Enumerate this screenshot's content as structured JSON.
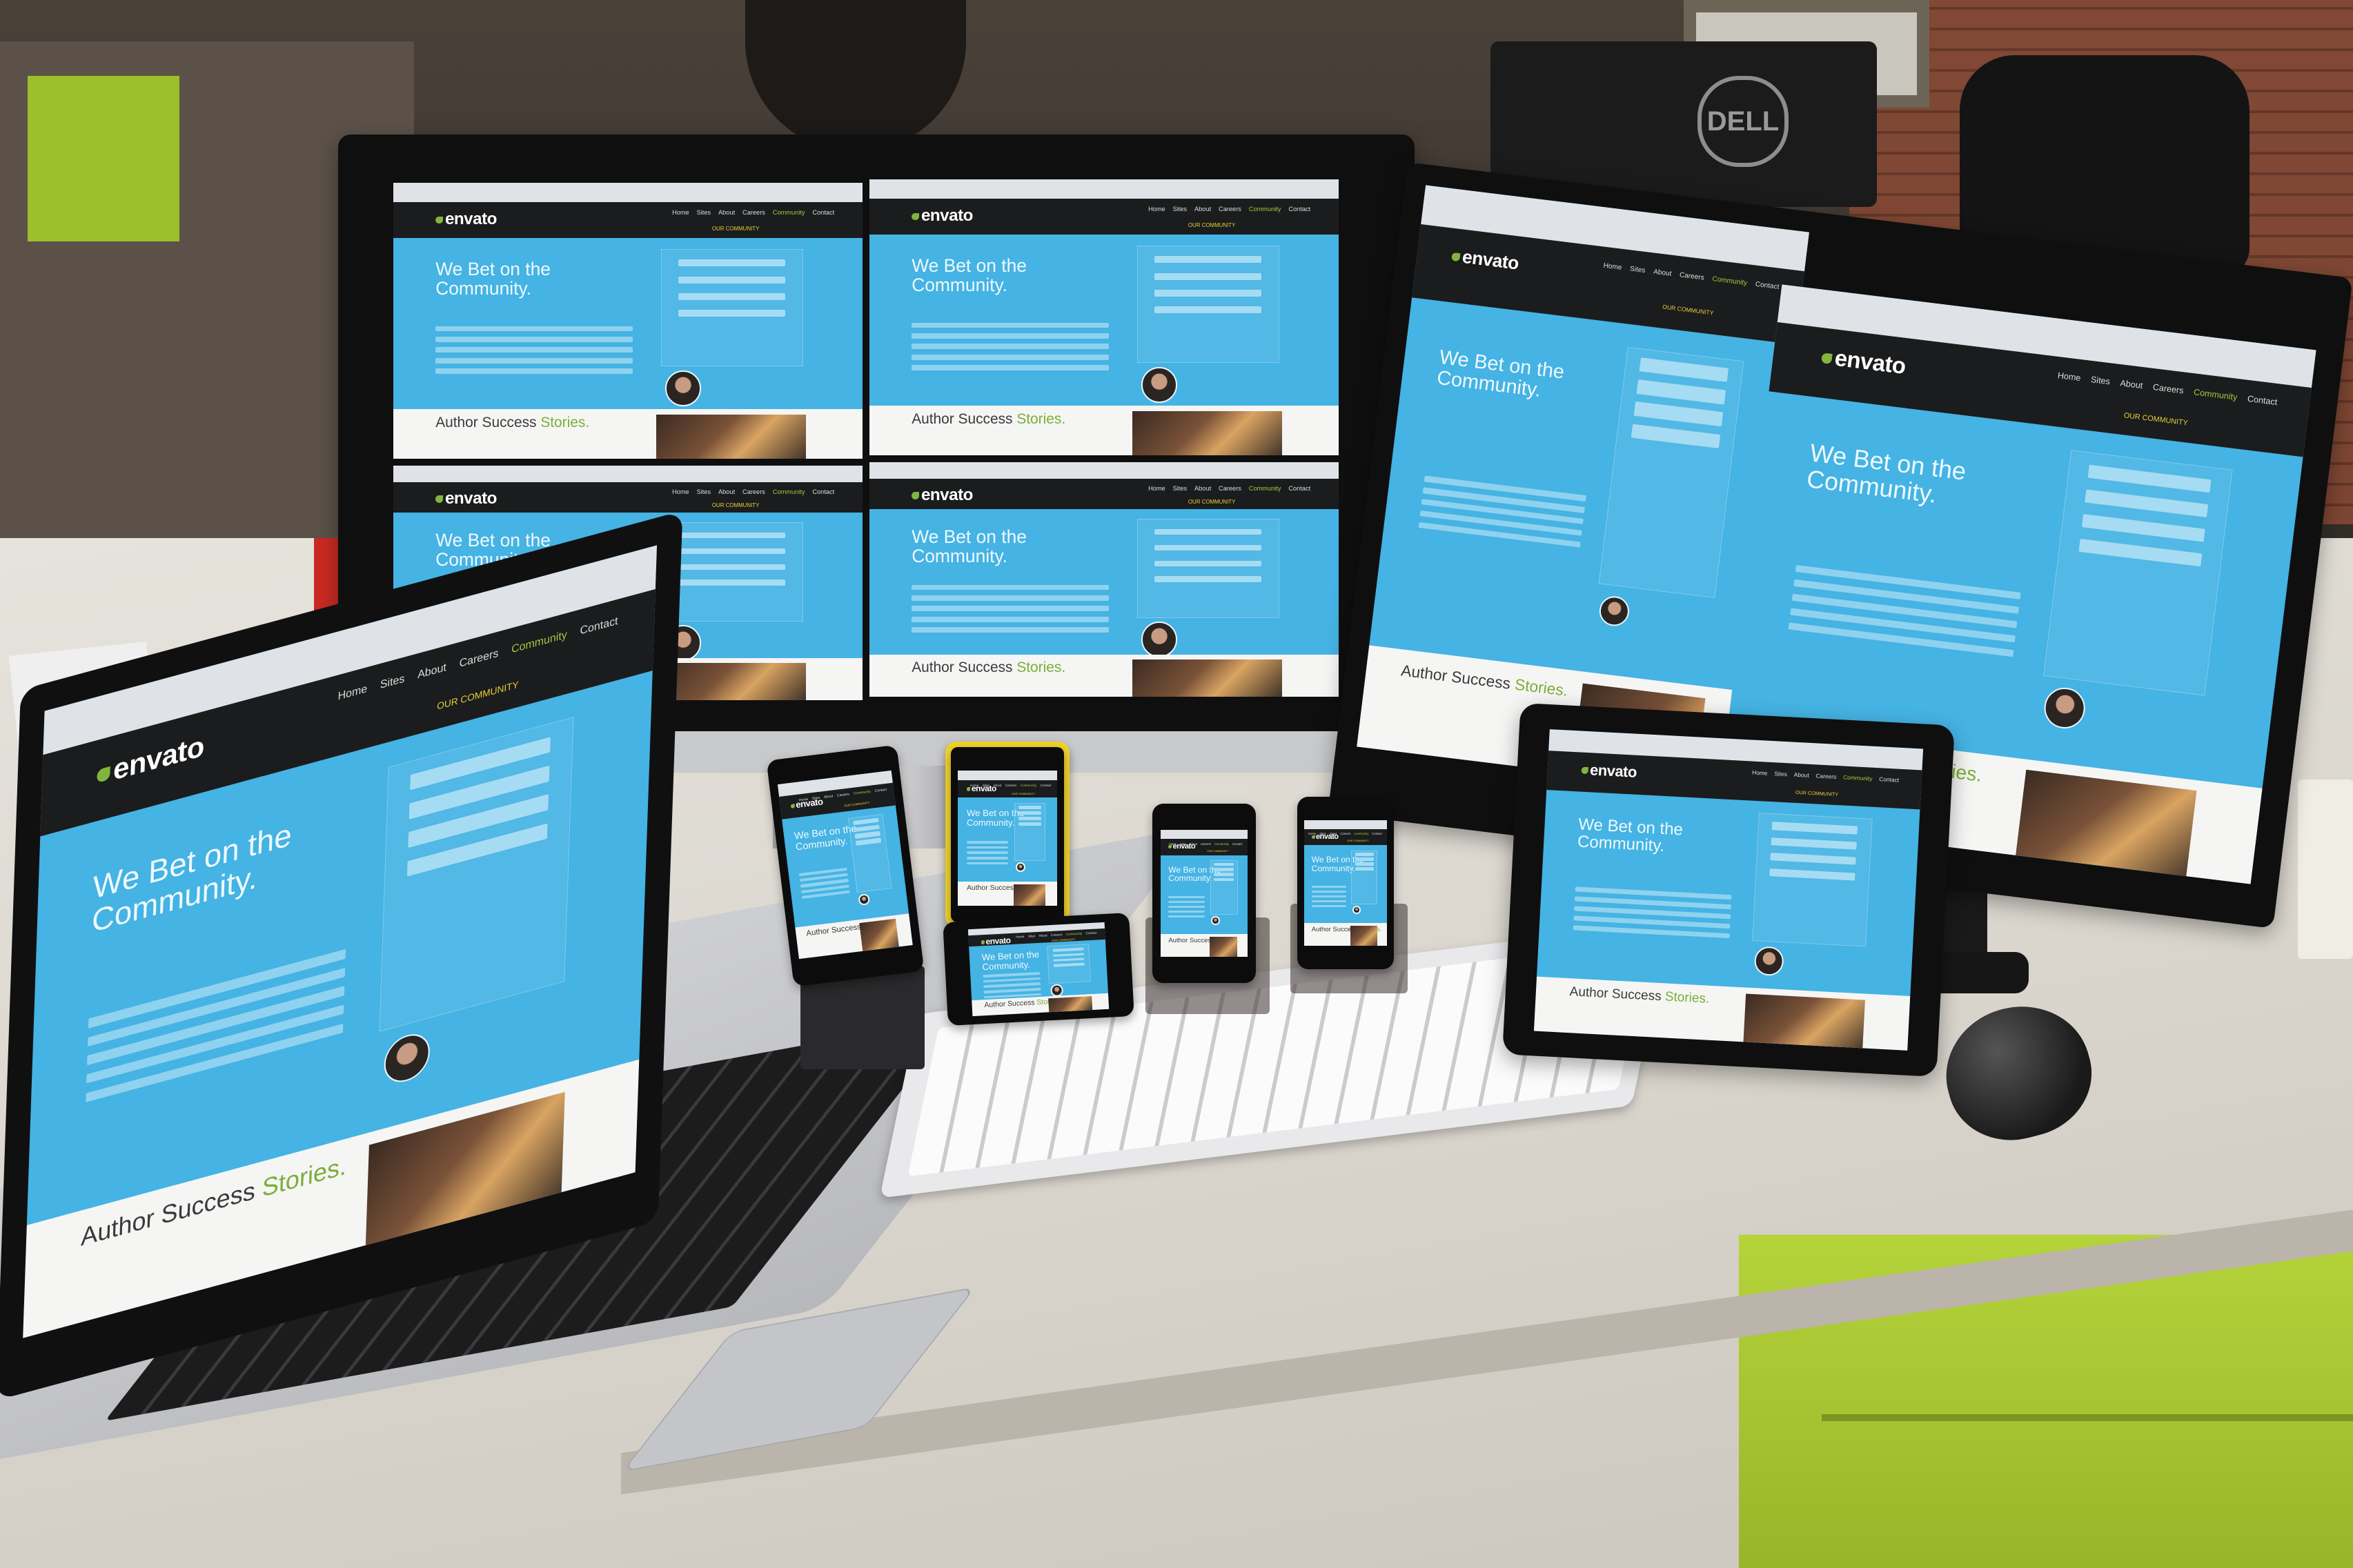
{
  "site": {
    "logo": "envato",
    "nav": [
      "Home",
      "Sites",
      "About",
      "Careers",
      "Community",
      "Contact"
    ],
    "nav_active": "Community",
    "subnav": "OUR COMMUNITY",
    "hero_line1": "We Bet on the",
    "hero_line2": "Community.",
    "section_title1": "Author Success",
    "section_title2": "Stories.",
    "accent": "#45b3e3",
    "nav_bg": "#1b1c1d",
    "green": "#82b540"
  },
  "monitor_brand": "DELL",
  "icons": {
    "logo_leaf": "leaf-icon",
    "quote_open": "quote-open-icon",
    "quote_close": "quote-close-icon"
  }
}
